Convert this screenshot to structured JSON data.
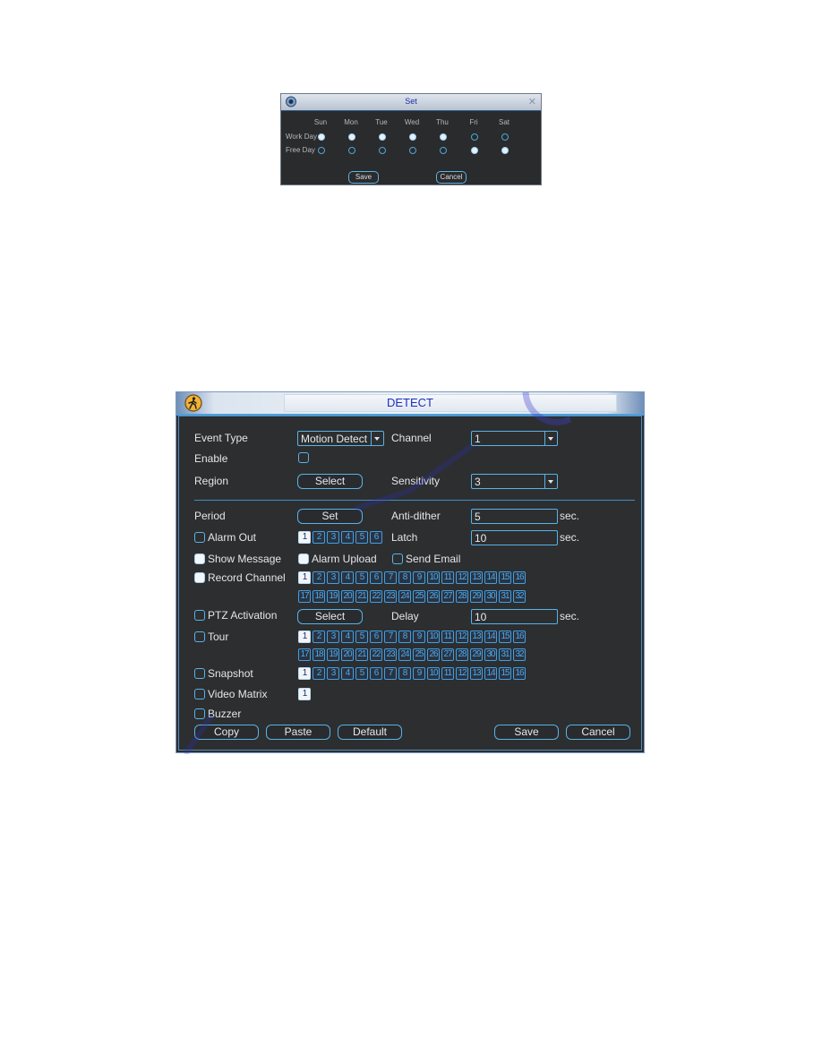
{
  "set_dialog": {
    "title": "Set",
    "icon": "camera-icon",
    "close_glyph": "✕",
    "days": [
      "Sun",
      "Mon",
      "Tue",
      "Wed",
      "Thu",
      "Fri",
      "Sat"
    ],
    "rows": [
      {
        "label": "Work Day",
        "selected": [
          true,
          true,
          true,
          true,
          true,
          false,
          false
        ]
      },
      {
        "label": "Free Day",
        "selected": [
          false,
          false,
          false,
          false,
          false,
          true,
          true
        ]
      }
    ],
    "save_label": "Save",
    "cancel_label": "Cancel"
  },
  "detect": {
    "title": "DETECT",
    "icon": "motion-person-icon",
    "event_type": {
      "label": "Event Type",
      "value": "Motion Detect"
    },
    "channel": {
      "label": "Channel",
      "value": "1"
    },
    "enable": {
      "label": "Enable",
      "checked": false
    },
    "region": {
      "label": "Region",
      "button": "Select"
    },
    "sensitivity": {
      "label": "Sensitivity",
      "value": "3"
    },
    "period": {
      "label": "Period",
      "button": "Set"
    },
    "anti_dither": {
      "label": "Anti-dither",
      "value": "5",
      "unit": "sec."
    },
    "alarm_out": {
      "label": "Alarm Out",
      "checked": false,
      "channels": [
        "1",
        "2",
        "3",
        "4",
        "5",
        "6"
      ],
      "selected": [
        "1"
      ]
    },
    "latch": {
      "label": "Latch",
      "value": "10",
      "unit": "sec."
    },
    "show_message": {
      "label": "Show Message",
      "checked": true
    },
    "alarm_upload": {
      "label": "Alarm Upload",
      "checked": true
    },
    "send_email": {
      "label": "Send Email",
      "checked": false
    },
    "record_channel": {
      "label": "Record Channel",
      "checked": true,
      "row1": [
        "1",
        "2",
        "3",
        "4",
        "5",
        "6",
        "7",
        "8",
        "9",
        "10",
        "11",
        "12",
        "13",
        "14",
        "15",
        "16"
      ],
      "row2": [
        "17",
        "18",
        "19",
        "20",
        "21",
        "22",
        "23",
        "24",
        "25",
        "26",
        "27",
        "28",
        "29",
        "30",
        "31",
        "32"
      ],
      "selected": [
        "1"
      ]
    },
    "ptz_activation": {
      "label": "PTZ Activation",
      "checked": false,
      "button": "Select"
    },
    "delay": {
      "label": "Delay",
      "value": "10",
      "unit": "sec."
    },
    "tour": {
      "label": "Tour",
      "checked": false,
      "row1": [
        "1",
        "2",
        "3",
        "4",
        "5",
        "6",
        "7",
        "8",
        "9",
        "10",
        "11",
        "12",
        "13",
        "14",
        "15",
        "16"
      ],
      "row2": [
        "17",
        "18",
        "19",
        "20",
        "21",
        "22",
        "23",
        "24",
        "25",
        "26",
        "27",
        "28",
        "29",
        "30",
        "31",
        "32"
      ],
      "selected": [
        "1"
      ]
    },
    "snapshot": {
      "label": "Snapshot",
      "checked": false,
      "row1": [
        "1",
        "2",
        "3",
        "4",
        "5",
        "6",
        "7",
        "8",
        "9",
        "10",
        "11",
        "12",
        "13",
        "14",
        "15",
        "16"
      ],
      "selected": [
        "1"
      ]
    },
    "video_matrix": {
      "label": "Video Matrix",
      "checked": false,
      "channels": [
        "1"
      ],
      "selected": [
        "1"
      ]
    },
    "buzzer": {
      "label": "Buzzer",
      "checked": false
    },
    "buttons": {
      "copy": "Copy",
      "paste": "Paste",
      "default": "Default",
      "save": "Save",
      "cancel": "Cancel"
    }
  }
}
